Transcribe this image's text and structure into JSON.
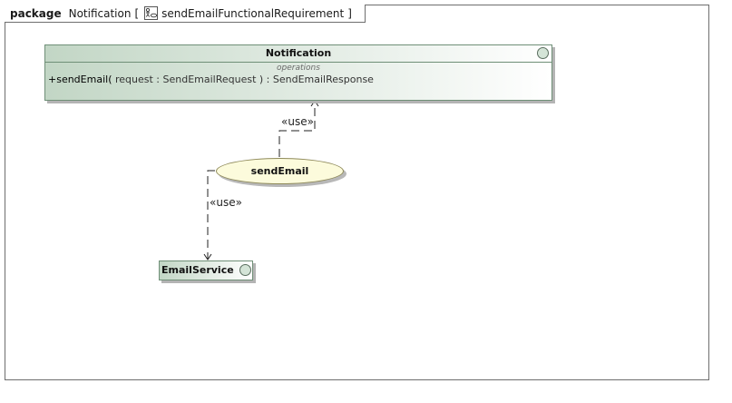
{
  "frame": {
    "keyword": "package",
    "owner": "Notification",
    "bracket_open": "[",
    "diagram_name": "sendEmailFunctionalRequirement",
    "bracket_close": "]",
    "diagram_icon": "use-case-diagram-icon"
  },
  "notification_class": {
    "name": "Notification",
    "compartment_label": "operations",
    "operation_visibility_name": "+sendEmail(",
    "operation_params": " request : SendEmailRequest ) : SendEmailResponse",
    "icon": "interface-circle-icon"
  },
  "use_case": {
    "name": "sendEmail"
  },
  "email_service": {
    "name": "EmailService",
    "icon": "interface-circle-icon"
  },
  "dependencies": [
    {
      "label": "«use»"
    },
    {
      "label": "«use»"
    }
  ],
  "colors": {
    "class_fill_start": "#c2d6c5",
    "use_case_fill": "#fcfbdc",
    "frame_border": "#6e6e6e"
  }
}
